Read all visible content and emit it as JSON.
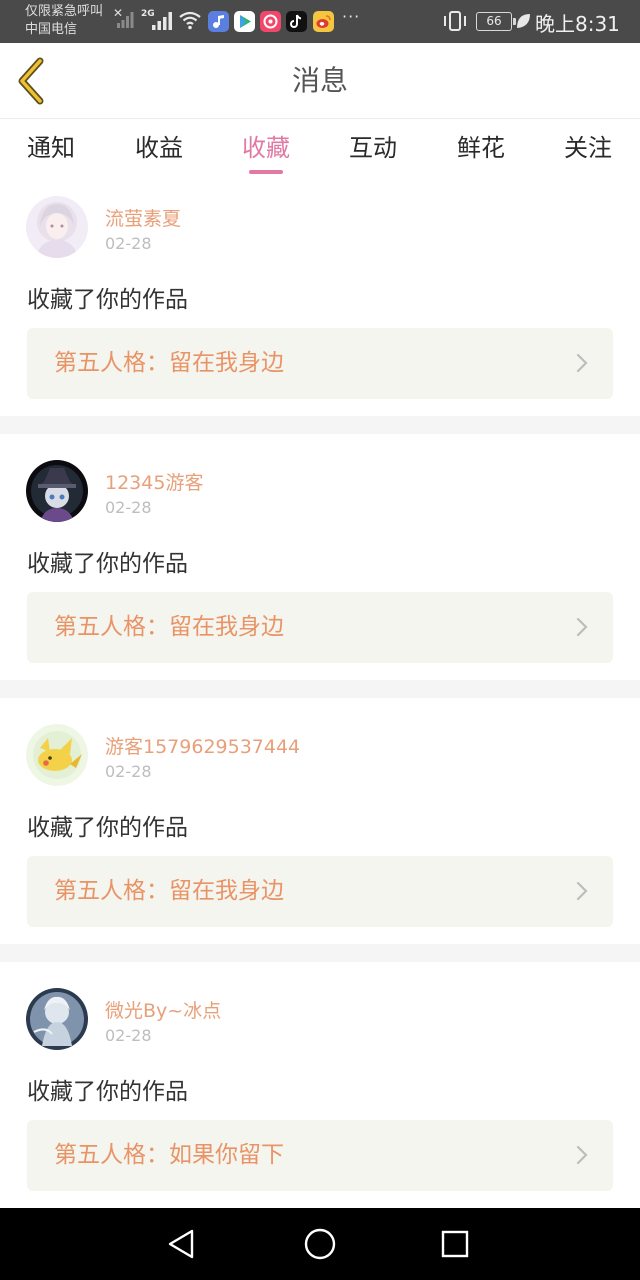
{
  "status_bar": {
    "emergency_text": "仅限紧急呼叫",
    "carrier": "中国电信",
    "network_label": "2G",
    "overflow": "···",
    "battery": "66",
    "time": "晚上8:31"
  },
  "header": {
    "title": "消息"
  },
  "tabs": [
    {
      "label": "通知",
      "active": false
    },
    {
      "label": "收益",
      "active": false
    },
    {
      "label": "收藏",
      "active": true
    },
    {
      "label": "互动",
      "active": false
    },
    {
      "label": "鲜花",
      "active": false
    },
    {
      "label": "关注",
      "active": false
    }
  ],
  "colors": {
    "accent_pink": "#e07aa4",
    "username_orange": "#e8a07a",
    "work_title_orange": "#e89466",
    "work_box_bg": "#f5f5ef"
  },
  "notifications": [
    {
      "username": "流萤素夏",
      "date": "02-28",
      "action": "收藏了你的作品",
      "work_title": "第五人格：留在我身边"
    },
    {
      "username": "12345游客",
      "date": "02-28",
      "action": "收藏了你的作品",
      "work_title": "第五人格：留在我身边"
    },
    {
      "username": "游客1579629537444",
      "date": "02-28",
      "action": "收藏了你的作品",
      "work_title": "第五人格：留在我身边"
    },
    {
      "username": "微光By~冰点",
      "date": "02-28",
      "action": "收藏了你的作品",
      "work_title": "第五人格：如果你留下"
    }
  ]
}
